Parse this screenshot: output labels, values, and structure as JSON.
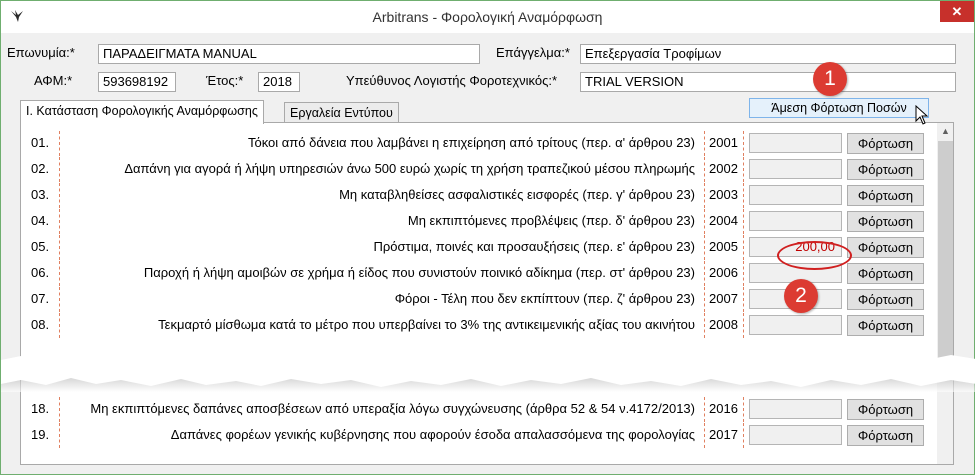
{
  "window": {
    "title": "Arbitrans - Φορολογική Αναμόρφωση",
    "close_label": "✕",
    "app_icon": "bird-logo-icon"
  },
  "form": {
    "name_label": "Επωνυμία:*",
    "name_value": "ΠΑΡΑΔΕΙΓΜΑΤΑ MANUAL",
    "profession_label": "Επάγγελμα:*",
    "profession_value": "Επεξεργασία Τροφίμων",
    "afm_label": "ΑΦΜ:*",
    "afm_value": "593698192",
    "year_label": "Έτος:*",
    "year_value": "2018",
    "accountant_label": "Υπεύθυνος Λογιστής Φοροτεχνικός:*",
    "accountant_value": "TRIAL VERSION"
  },
  "tabs": [
    {
      "label": "Ι. Κατάσταση Φορολογικής Αναμόρφωσης",
      "active": true
    },
    {
      "label": "Εργαλεία Εντύπου",
      "active": false
    }
  ],
  "load_all_button": "Άμεση Φόρτωση Ποσών",
  "button_label": "Φόρτωση",
  "rows": [
    {
      "num": "01.",
      "desc": "Τόκοι από δάνεια που λαμβάνει η επιχείρηση από τρίτους (περ. α' άρθρου 23)",
      "code": "2001",
      "amount": ""
    },
    {
      "num": "02.",
      "desc": "Δαπάνη για αγορά ή λήψη υπηρεσιών άνω 500 ευρώ χωρίς τη χρήση τραπεζικού μέσου πληρωμής",
      "code": "2002",
      "amount": ""
    },
    {
      "num": "03.",
      "desc": "Μη καταβληθείσες ασφαλιστικές εισφορές (περ. γ' άρθρου 23)",
      "code": "2003",
      "amount": ""
    },
    {
      "num": "04.",
      "desc": "Μη εκπιπτόμενες προβλέψεις (περ. δ' άρθρου 23)",
      "code": "2004",
      "amount": ""
    },
    {
      "num": "05.",
      "desc": "Πρόστιμα, ποινές και προσαυξήσεις (περ. ε' άρθρου 23)",
      "code": "2005",
      "amount": "200,00"
    },
    {
      "num": "06.",
      "desc": "Παροχή ή λήψη αμοιβών σε χρήμα ή είδος που συνιστούν ποινικό αδίκημα (περ. στ' άρθρου 23)",
      "code": "2006",
      "amount": ""
    },
    {
      "num": "07.",
      "desc": "Φόροι - Τέλη που δεν εκπίπτουν (περ. ζ' άρθρου 23)",
      "code": "2007",
      "amount": ""
    },
    {
      "num": "08.",
      "desc": "Τεκμαρτό μίσθωμα κατά το μέτρο που υπερβαίνει το 3% της αντικειμενικής αξίας του ακινήτου",
      "code": "2008",
      "amount": ""
    },
    {
      "num": "18.",
      "desc": "Μη εκπιπτόμενες δαπάνες αποσβέσεων από υπεραξία λόγω συγχώνευσης (άρθρα 52 & 54 ν.4172/2013)",
      "code": "2016",
      "amount": ""
    },
    {
      "num": "19.",
      "desc": "Δαπάνες φορέων γενικής κυβέρνησης που αφορούν έσοδα απαλασσόμενα της φορολογίας",
      "code": "2017",
      "amount": ""
    }
  ],
  "annotations": [
    {
      "label": "1"
    },
    {
      "label": "2"
    }
  ],
  "colors": {
    "accent_red": "#dc3b32",
    "amount_red": "#c00000",
    "dashed_line": "#e08060"
  }
}
